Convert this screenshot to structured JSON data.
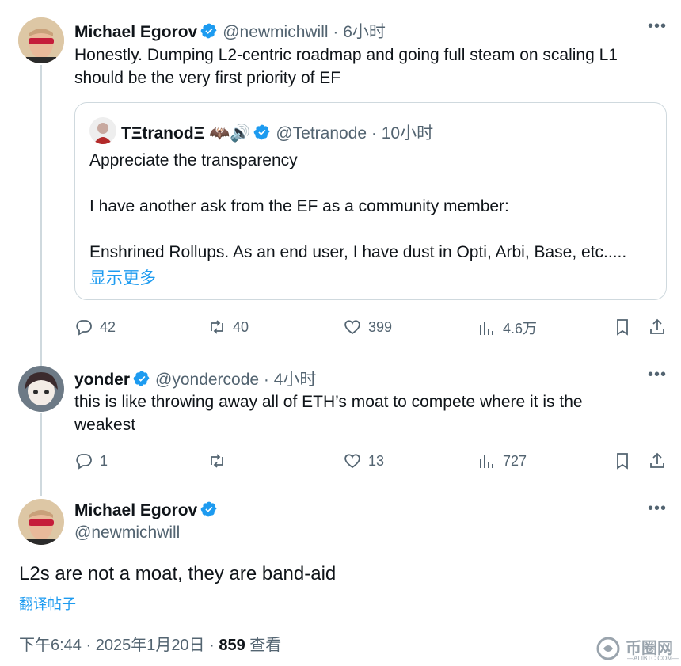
{
  "tweet1": {
    "name": "Michael Egorov",
    "handle_time": "@newmichwill · 6小时",
    "text_line1": "Honestly. Dumping L2-centric roadmap and going full steam on scaling L1",
    "text_line2": "should be the very first priority of EF",
    "quote": {
      "name": "TΞtranodΞ 🦇🔊",
      "handle_time": "@Tetranode · 10小时",
      "line1": "Appreciate the transparency",
      "line2": "I have another ask from the EF as a community member:",
      "line3": "Enshrined Rollups. As an end user, I have dust in Opti, Arbi, Base, etc.....",
      "show_more": "显示更多"
    },
    "replies": "42",
    "reposts": "40",
    "likes": "399",
    "views": "4.6万"
  },
  "tweet2": {
    "name": "yonder",
    "handle_time": "@yondercode · 4小时",
    "text_line1": "this is like throwing away all of ETH’s moat to compete where it is the",
    "text_line2": "weakest",
    "replies": "1",
    "likes": "13",
    "views": "727"
  },
  "main": {
    "name": "Michael Egorov",
    "handle": "@newmichwill",
    "text": "L2s are not a moat, they are band-aid",
    "translate": "翻译帖子",
    "meta_time": "下午6:44 · 2025年1月20日 · ",
    "views_count": "859",
    "views_label": "查看"
  },
  "watermark": {
    "text": "币圈网",
    "sub": "—ALIBTC.COM—"
  },
  "colors": {
    "accent": "#1d9bf0",
    "text": "#0f1419",
    "secondary": "#536471",
    "border": "#cfd9de"
  }
}
